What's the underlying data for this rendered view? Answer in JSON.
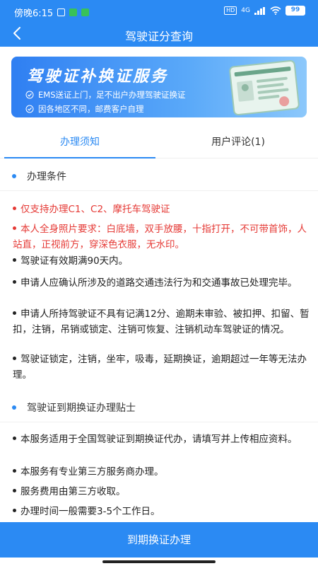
{
  "status_bar": {
    "time": "傍晚6:15",
    "network": "4G",
    "battery": "99"
  },
  "header": {
    "title": "驾驶证分查询",
    "back_icon": "chevron-left-icon"
  },
  "banner": {
    "title": "驾驶证补换证服务",
    "lines": [
      "EMS送证上门，足不出户办理驾驶证换证",
      "因各地区不同，邮费客户自理"
    ]
  },
  "tabs": [
    {
      "label": "办理须知",
      "active": true
    },
    {
      "label": "用户评论(1)",
      "active": false
    }
  ],
  "sections": [
    {
      "title": "办理条件",
      "items": [
        {
          "text": "仅支持办理C1、C2、摩托车驾驶证",
          "highlight": true
        },
        {
          "text": "本人全身照片要求：白底墙，双手放腰，十指打开，不可带首饰，人站直，正视前方，穿深色衣服，无水印。",
          "highlight": true
        },
        {
          "text": "驾驶证有效期满90天内。",
          "highlight": false
        },
        {
          "text": "申请人应确认所涉及的道路交通违法行为和交通事故已处理完毕。",
          "highlight": false
        },
        {
          "text": "申请人所持驾驶证不具有记满12分、逾期未审验、被扣押、扣留、暂扣，注销，吊销或锁定、注销可恢复、注销机动车驾驶证的情况。",
          "highlight": false
        },
        {
          "text": "驾驶证锁定，注销，坐牢，吸毒，延期换证，逾期超过一年等无法办理。",
          "highlight": false
        }
      ]
    },
    {
      "title": "驾驶证到期换证办理贴士",
      "items": [
        {
          "text": "本服务适用于全国驾驶证到期换证代办，请填写并上传相应资料。",
          "highlight": false
        },
        {
          "text": "本服务有专业第三方服务商办理。",
          "highlight": false
        },
        {
          "text": "服务费用由第三方收取。",
          "highlight": false
        },
        {
          "text": "办理时间一般需要3-5个工作日。",
          "highlight": false
        }
      ]
    }
  ],
  "bottom_button": {
    "label": "到期换证办理"
  },
  "colors": {
    "primary": "#2b8af3",
    "warning": "#e53935"
  }
}
